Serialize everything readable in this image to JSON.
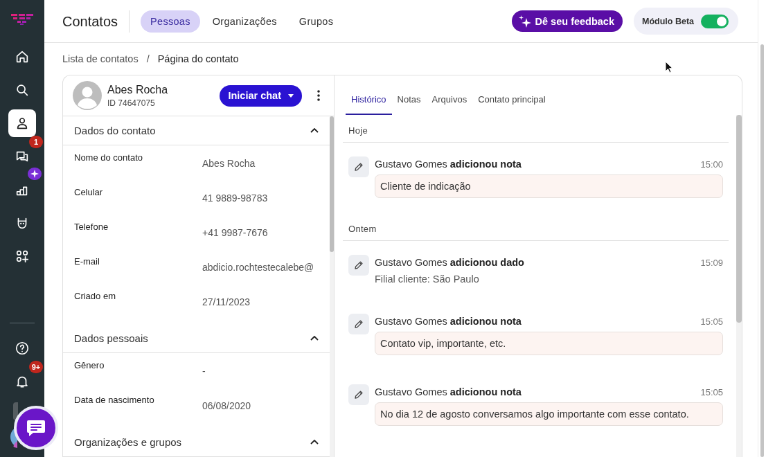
{
  "sidebar": {
    "items": [
      {
        "kind": "home",
        "selected": false
      },
      {
        "kind": "search",
        "selected": false
      },
      {
        "kind": "contacts",
        "selected": true
      },
      {
        "kind": "chats",
        "selected": false,
        "badge": {
          "kind": "count",
          "text": "1"
        }
      },
      {
        "kind": "reports",
        "selected": false,
        "badge": {
          "kind": "sparkle"
        }
      },
      {
        "kind": "bot",
        "selected": false
      },
      {
        "kind": "apps",
        "selected": false
      }
    ],
    "bottom_items": [
      {
        "kind": "help"
      },
      {
        "kind": "bell",
        "badge": {
          "kind": "count",
          "text": "9+"
        }
      },
      {
        "kind": "workspace"
      },
      {
        "kind": "avatar"
      }
    ]
  },
  "header": {
    "title": "Contatos",
    "tabs": [
      {
        "label": "Pessoas",
        "selected": true
      },
      {
        "label": "Organizações",
        "selected": false
      },
      {
        "label": "Grupos",
        "selected": false
      }
    ],
    "feedback_button": "Dê seu feedback",
    "beta": {
      "label": "Módulo Beta",
      "on": true
    }
  },
  "breadcrumb": [
    {
      "label": "Lista de contatos"
    },
    {
      "label": "/"
    },
    {
      "label": "Página do contato"
    }
  ],
  "contact": {
    "name": "Abes Rocha",
    "id": "ID 74647075",
    "chat_button": "Iniciar chat",
    "sections": [
      {
        "title": "Dados do contato",
        "expanded": true,
        "fields": [
          {
            "label": "Nome do contato",
            "value": "Abes Rocha"
          },
          {
            "label": "Celular",
            "value": "41 9889-98783"
          },
          {
            "label": "Telefone",
            "value": "+41 9987-7676"
          },
          {
            "label": "E-mail",
            "value": "abdicio.rochtestecalebe@"
          },
          {
            "label": "Criado em",
            "value": "27/11/2023"
          }
        ]
      },
      {
        "title": "Dados pessoais",
        "expanded": true,
        "fields": [
          {
            "label": "Gênero",
            "value": "-"
          },
          {
            "label": "Data de nascimento",
            "value": "06/08/2020"
          }
        ]
      },
      {
        "title": "Organizações e grupos",
        "expanded": true
      }
    ]
  },
  "history": {
    "tabs": [
      {
        "label": "Histórico",
        "selected": true
      },
      {
        "label": "Notas",
        "selected": false
      },
      {
        "label": "Arquivos",
        "selected": false
      },
      {
        "label": "Contato principal",
        "selected": false
      }
    ],
    "groups": [
      {
        "heading": "Hoje",
        "events": [
          {
            "kind": "note",
            "text": "Gustavo Gomes **adicionou nota**",
            "time": "15:00",
            "detail": "Cliente de indicação"
          }
        ]
      },
      {
        "heading": "Ontem",
        "events": [
          {
            "kind": "data",
            "text": "Gustavo Gomes **adicionou dado**",
            "time": "15:09",
            "detail": "Filial cliente: São Paulo"
          },
          {
            "kind": "note",
            "text": "Gustavo Gomes **adicionou nota**",
            "time": "15:05",
            "detail": "Contato vip, importante, etc."
          },
          {
            "kind": "note",
            "text": "Gustavo Gomes **adicionou nota**",
            "time": "15:05",
            "detail": "No dia 12 de agosto conversamos algo importante com esse contato."
          }
        ]
      }
    ]
  }
}
